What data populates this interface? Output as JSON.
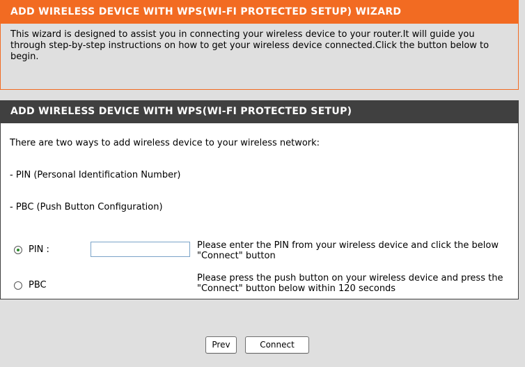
{
  "wizard": {
    "title": "ADD WIRELESS DEVICE WITH WPS(WI-FI PROTECTED SETUP) WIZARD",
    "description": "This wizard is designed to assist you in connecting your wireless device to your router.It will guide you through step-by-step instructions on how to get your wireless device connected.Click the button below to begin."
  },
  "wps": {
    "title": "ADD WIRELESS DEVICE WITH WPS(WI-FI PROTECTED SETUP)",
    "intro": "There are two ways to add wireless device to your wireless network:",
    "method_pin": "- PIN (Personal Identification Number)",
    "method_pbc": "- PBC (Push Button Configuration)",
    "options": {
      "pin_label": "PIN :",
      "pin_value": "",
      "pin_desc": "Please enter the PIN from your wireless device and click the below \"Connect\" button",
      "pbc_label": "PBC",
      "pbc_desc": "Please press the push button on your wireless device and press the \"Connect\" button below within 120 seconds",
      "selected": "PIN"
    }
  },
  "buttons": {
    "prev": "Prev",
    "connect": "Connect"
  },
  "colors": {
    "wizard_header": "#f26b22",
    "section_header": "#404040",
    "page_bg": "#dfdfdf"
  }
}
